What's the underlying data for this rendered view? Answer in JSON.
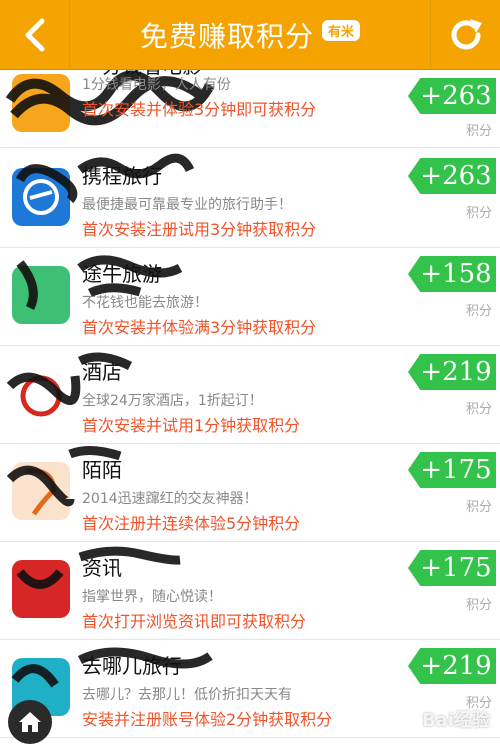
{
  "header": {
    "title": "免费赚取积分",
    "brand_badge": "有米"
  },
  "items": [
    {
      "name": "一分钱看电影",
      "desc": "1分钱看电影，人人有份",
      "task": "首次安装并体验3分钟即可获积分",
      "points": "+263",
      "unit": "积分",
      "icon_color": "#f7a51c"
    },
    {
      "name": "携程旅行",
      "desc": "最便捷最可靠最专业的旅行助手！",
      "task": "首次安装注册试用3分钟获取积分",
      "points": "+263",
      "unit": "积分",
      "icon_color": "#1e78d8"
    },
    {
      "name": "途牛旅游",
      "desc": "不花钱也能去旅游！",
      "task": "首次安装并体验满3分钟获取积分",
      "points": "+158",
      "unit": "积分",
      "icon_color": "#3dbf74"
    },
    {
      "name": "酒店",
      "desc": "全球24万家酒店，1折起订！",
      "task": "首次安装并试用1分钟获取积分",
      "points": "+219",
      "unit": "积分",
      "icon_color": "#d8281e"
    },
    {
      "name": "陌陌",
      "desc": "2014迅速蹿红的交友神器！",
      "task": "首次注册并连续体验5分钟积分",
      "points": "+175",
      "unit": "积分",
      "icon_color": "#f0a060"
    },
    {
      "name": "资讯",
      "desc": "指掌世界，随心悦读！",
      "task": "首次打开浏览资讯即可获取积分",
      "points": "+175",
      "unit": "积分",
      "icon_color": "#d62626"
    },
    {
      "name": "去哪儿旅行",
      "desc": "去哪儿？去那儿！低价折扣天天有",
      "task": "安装并注册账号体验2分钟获取积分",
      "points": "+219",
      "unit": "积分",
      "icon_color": "#1fb0c8"
    }
  ],
  "colors": {
    "header": "#f5a300",
    "points": "#33c24a",
    "task": "#f0542a"
  },
  "watermark": "Bai经验"
}
